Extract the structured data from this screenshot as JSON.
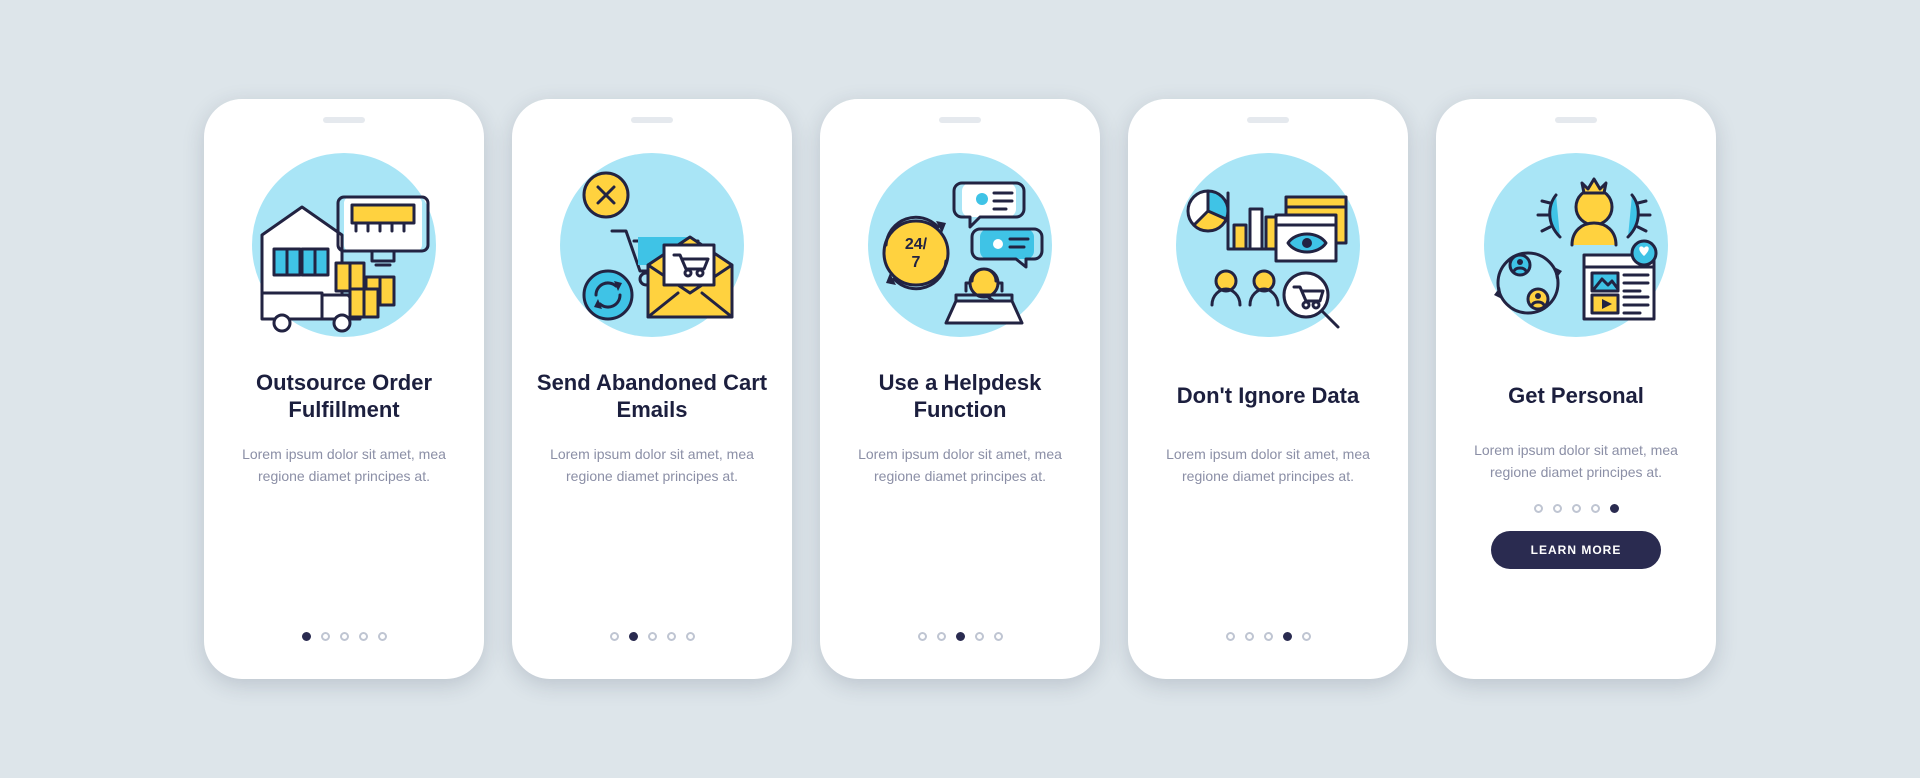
{
  "colors": {
    "ink": "#222342",
    "accent_yellow": "#ffd23f",
    "accent_blue": "#3fc3e6",
    "bg_circle": "#a9e5f6",
    "cta_bg": "#2a2b50",
    "page_bg": "#dde5ea"
  },
  "dots_per_card": 5,
  "cards": [
    {
      "title": "Outsource Order Fulfillment",
      "desc": "Lorem ipsum dolor sit amet, mea regione diamet principes at.",
      "active_dot": 0,
      "icon": "warehouse-shipping-icon"
    },
    {
      "title": "Send Abandoned Cart Emails",
      "desc": "Lorem ipsum dolor sit amet, mea regione diamet principes at.",
      "active_dot": 1,
      "icon": "abandoned-cart-email-icon"
    },
    {
      "title": "Use a Helpdesk Function",
      "desc": "Lorem ipsum dolor sit amet, mea regione diamet principes at.",
      "active_dot": 2,
      "icon": "helpdesk-support-icon"
    },
    {
      "title": "Don't Ignore Data",
      "desc": "Lorem ipsum dolor sit amet, mea regione diamet principes at.",
      "active_dot": 3,
      "icon": "analytics-data-icon"
    },
    {
      "title": "Get Personal",
      "desc": "Lorem ipsum dolor sit amet, mea regione diamet principes at.",
      "active_dot": 4,
      "icon": "personal-user-icon",
      "cta_label": "LEARN MORE"
    }
  ]
}
